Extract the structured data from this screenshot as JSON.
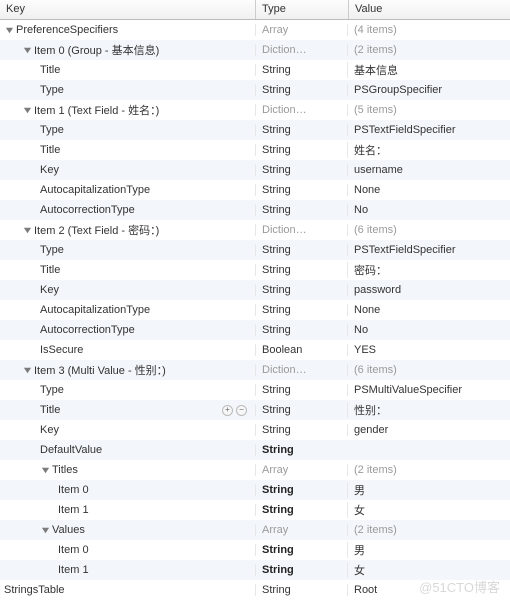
{
  "columns": {
    "key": "Key",
    "type": "Type",
    "value": "Value"
  },
  "watermark": "@51CTO博客",
  "rows": [
    {
      "indent": 0,
      "disclosure": true,
      "key": "PreferenceSpecifiers",
      "type": "Array",
      "value": "(4 items)",
      "gray": true
    },
    {
      "indent": 1,
      "disclosure": true,
      "key": "Item 0 (Group - 基本信息)",
      "type": "Diction…",
      "value": "(2 items)",
      "gray": true
    },
    {
      "indent": 2,
      "key": "Title",
      "type": "String",
      "value": "基本信息"
    },
    {
      "indent": 2,
      "key": "Type",
      "type": "String",
      "value": "PSGroupSpecifier"
    },
    {
      "indent": 1,
      "disclosure": true,
      "key": "Item 1 (Text Field - 姓名：)",
      "type": "Diction…",
      "value": "(5 items)",
      "gray": true
    },
    {
      "indent": 2,
      "key": "Type",
      "type": "String",
      "value": "PSTextFieldSpecifier"
    },
    {
      "indent": 2,
      "key": "Title",
      "type": "String",
      "value": "姓名："
    },
    {
      "indent": 2,
      "key": "Key",
      "type": "String",
      "value": "username"
    },
    {
      "indent": 2,
      "key": "AutocapitalizationType",
      "type": "String",
      "value": "None"
    },
    {
      "indent": 2,
      "key": "AutocorrectionType",
      "type": "String",
      "value": "No"
    },
    {
      "indent": 1,
      "disclosure": true,
      "key": "Item 2 (Text Field - 密码：)",
      "type": "Diction…",
      "value": "(6 items)",
      "gray": true
    },
    {
      "indent": 2,
      "key": "Type",
      "type": "String",
      "value": "PSTextFieldSpecifier"
    },
    {
      "indent": 2,
      "key": "Title",
      "type": "String",
      "value": "密码："
    },
    {
      "indent": 2,
      "key": "Key",
      "type": "String",
      "value": "password"
    },
    {
      "indent": 2,
      "key": "AutocapitalizationType",
      "type": "String",
      "value": "None"
    },
    {
      "indent": 2,
      "key": "AutocorrectionType",
      "type": "String",
      "value": "No"
    },
    {
      "indent": 2,
      "key": "IsSecure",
      "type": "Boolean",
      "value": "YES"
    },
    {
      "indent": 1,
      "disclosure": true,
      "key": "Item 3 (Multi Value - 性别：)",
      "type": "Diction…",
      "value": "(6 items)",
      "gray": true
    },
    {
      "indent": 2,
      "key": "Type",
      "type": "String",
      "value": "PSMultiValueSpecifier"
    },
    {
      "indent": 2,
      "key": "Title",
      "type": "String",
      "value": "性别：",
      "addremove": true
    },
    {
      "indent": 2,
      "key": "Key",
      "type": "String",
      "value": "gender"
    },
    {
      "indent": 2,
      "key": "DefaultValue",
      "type": "String",
      "value": "",
      "bold": true
    },
    {
      "indent": 2,
      "disclosure": true,
      "key": "Titles",
      "type": "Array",
      "value": "(2 items)",
      "gray": true
    },
    {
      "indent": 3,
      "key": "Item 0",
      "type": "String",
      "value": "男",
      "bold": true
    },
    {
      "indent": 3,
      "key": "Item 1",
      "type": "String",
      "value": "女",
      "bold": true
    },
    {
      "indent": 2,
      "disclosure": true,
      "key": "Values",
      "type": "Array",
      "value": "(2 items)",
      "gray": true
    },
    {
      "indent": 3,
      "key": "Item 0",
      "type": "String",
      "value": "男",
      "bold": true
    },
    {
      "indent": 3,
      "key": "Item 1",
      "type": "String",
      "value": "女",
      "bold": true
    },
    {
      "indent": 0,
      "key": "StringsTable",
      "type": "String",
      "value": "Root"
    }
  ]
}
